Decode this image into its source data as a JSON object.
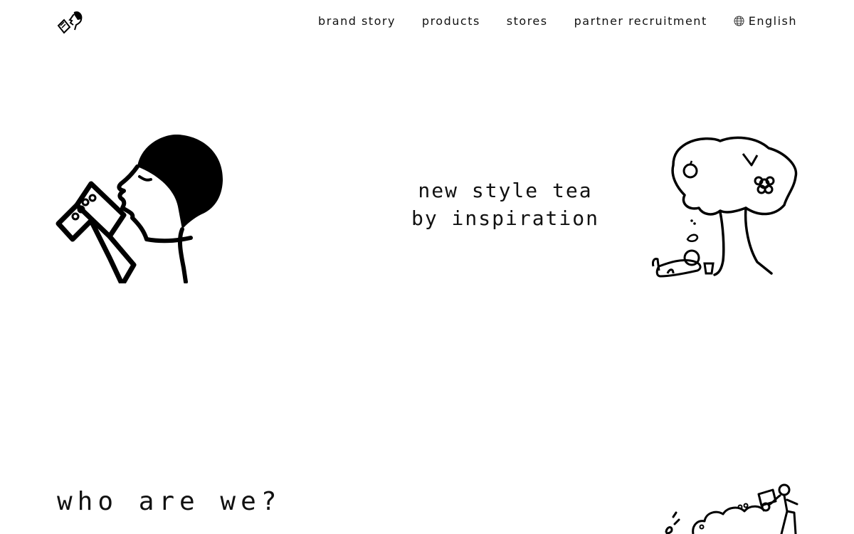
{
  "header": {
    "nav": [
      {
        "id": "brand-story",
        "label": "brand story"
      },
      {
        "id": "products",
        "label": "products"
      },
      {
        "id": "stores",
        "label": "stores"
      },
      {
        "id": "partner-recruitment",
        "label": "partner recruitment"
      }
    ],
    "language": {
      "label": "English",
      "icon": "globe-icon"
    }
  },
  "hero": {
    "tagline_line1": "new style tea",
    "tagline_line2": "by inspiration",
    "left_illustration": "person-drinking-tea-illustration",
    "right_illustration": "tree-picnic-illustration"
  },
  "about": {
    "title": "who are we?",
    "illustration": "person-with-cloud-illustration"
  }
}
